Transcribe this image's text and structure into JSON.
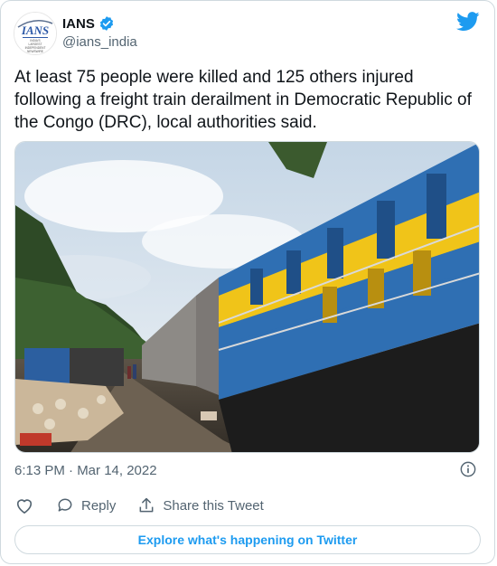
{
  "author": {
    "name": "IANS",
    "handle": "@ians_india",
    "verified": true,
    "avatar_logo_text": "IANS",
    "avatar_tagline": "INDIA'S LARGEST INDEPENDENT NEWSWIRE"
  },
  "tweet": {
    "text": "At least 75 people were killed and 125 others injured following a freight train derailment in Democratic Republic of the Congo (DRC), local authorities said.",
    "timestamp": "6:13 PM · Mar 14, 2022"
  },
  "actions": {
    "like_icon": "heart-icon",
    "reply_label": "Reply",
    "share_label": "Share this Tweet"
  },
  "footer": {
    "explore_label": "Explore what's happening on Twitter"
  },
  "colors": {
    "brand": "#1d9bf0",
    "text": "#0f1419",
    "muted": "#536471",
    "border": "#cfd9de"
  }
}
